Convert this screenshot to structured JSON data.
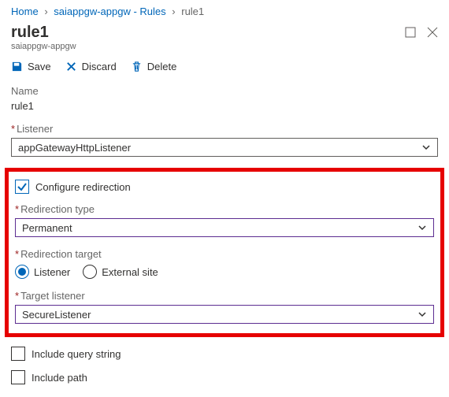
{
  "breadcrumb": {
    "items": [
      {
        "label": "Home",
        "link": true
      },
      {
        "label": "saiappgw-appgw - Rules",
        "link": true
      },
      {
        "label": "rule1",
        "link": false
      }
    ]
  },
  "header": {
    "title": "rule1",
    "subtitle": "saiappgw-appgw"
  },
  "toolbar": {
    "save": "Save",
    "discard": "Discard",
    "delete": "Delete"
  },
  "form": {
    "name_label": "Name",
    "name_value": "rule1",
    "listener_label": "Listener",
    "listener_value": "appGatewayHttpListener",
    "configure_redirect_label": "Configure redirection",
    "configure_redirect_checked": true,
    "redirection_type_label": "Redirection type",
    "redirection_type_value": "Permanent",
    "redirection_target_label": "Redirection target",
    "redirection_target_options": {
      "listener": "Listener",
      "external": "External site"
    },
    "redirection_target_selected": "listener",
    "target_listener_label": "Target listener",
    "target_listener_value": "SecureListener",
    "include_query_string_label": "Include query string",
    "include_path_label": "Include path"
  }
}
